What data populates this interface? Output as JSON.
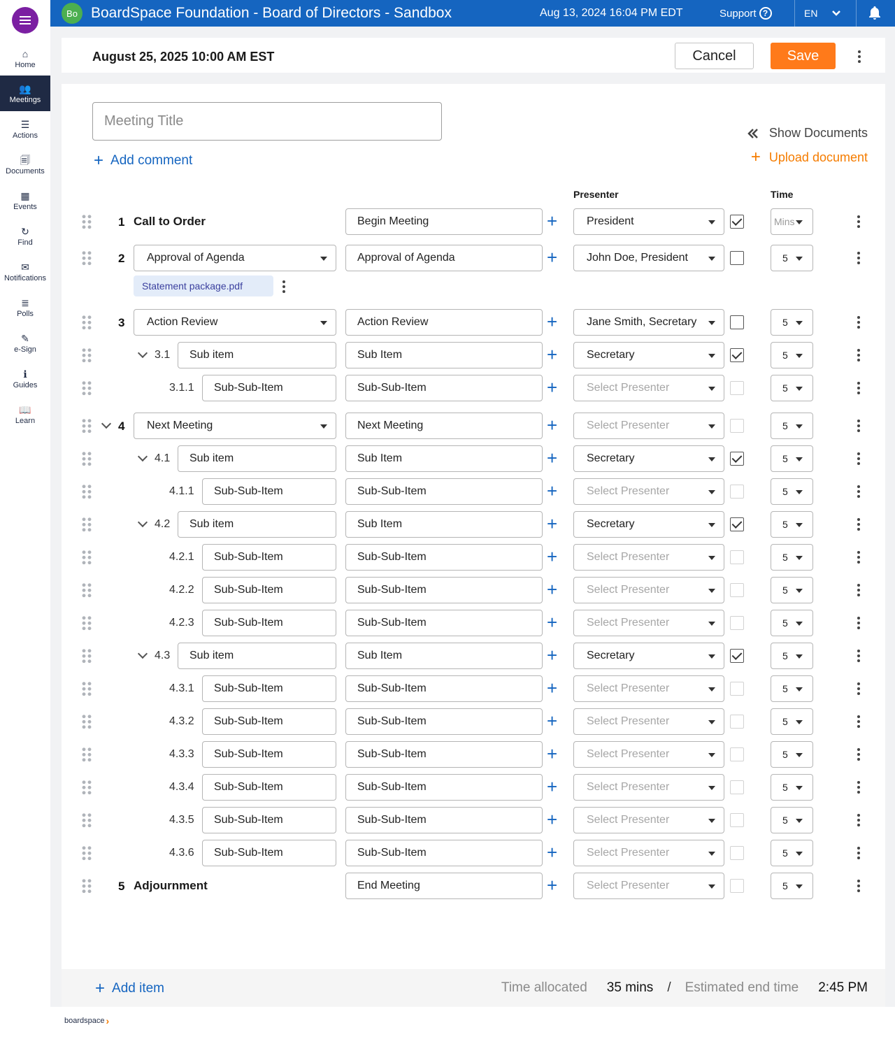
{
  "app": {
    "org_badge": "Bo",
    "title": "BoardSpace Foundation - Board of Directors - Sandbox",
    "datetime": "Aug 13, 2024 16:04 PM  EDT",
    "support_label": "Support",
    "language": "EN",
    "brand_color": "#1565c0"
  },
  "sidebar": {
    "items": [
      {
        "label": "Home",
        "icon": "home-icon",
        "glyph": "⌂"
      },
      {
        "label": "Meetings",
        "icon": "people-icon",
        "glyph": "👥",
        "active": true
      },
      {
        "label": "Actions",
        "icon": "list-icon",
        "glyph": "☰"
      },
      {
        "label": "Documents",
        "icon": "document-icon",
        "glyph": "🗐"
      },
      {
        "label": "Events",
        "icon": "calendar-icon",
        "glyph": "▦"
      },
      {
        "label": "Find",
        "icon": "history-icon",
        "glyph": "↻"
      },
      {
        "label": "Notifications",
        "icon": "envelope-icon",
        "glyph": "✉"
      },
      {
        "label": "Polls",
        "icon": "polls-icon",
        "glyph": "≣"
      },
      {
        "label": "e-Sign",
        "icon": "pen-icon",
        "glyph": "✎"
      },
      {
        "label": "Guides",
        "icon": "info-icon",
        "glyph": "ℹ"
      },
      {
        "label": "Learn",
        "icon": "book-icon",
        "glyph": "📖"
      }
    ]
  },
  "header": {
    "meeting_date": "August 25, 2025 10:00 AM EST",
    "cancel_label": "Cancel",
    "save_label": "Save",
    "save_color": "#ff7a1a"
  },
  "main": {
    "title_placeholder": "Meeting Title",
    "add_comment_label": "Add comment",
    "show_documents_label": "Show Documents",
    "upload_document_label": "Upload document",
    "presenter_header": "Presenter",
    "time_header": "Time",
    "attachment": "Statement package.pdf"
  },
  "agenda": [
    {
      "num": "1",
      "level": 0,
      "title": "Call to Order",
      "desc": "Begin Meeting",
      "presenter": "President",
      "presenter_set": true,
      "checked": true,
      "time": "Mins",
      "time_set": false
    },
    {
      "num": "2",
      "level": 0,
      "select": "Approval of Agenda",
      "desc": "Approval of Agenda",
      "presenter": "John Doe, President",
      "presenter_set": true,
      "checked": false,
      "time": "5",
      "time_set": true
    },
    {
      "num": "3",
      "level": 0,
      "select": "Action Review",
      "desc": "Action Review",
      "presenter": "Jane Smith, Secretary",
      "presenter_set": true,
      "checked": false,
      "time": "5",
      "time_set": true
    },
    {
      "num": "3.1",
      "level": 1,
      "collapsible": true,
      "name": "Sub item",
      "desc": "Sub Item",
      "presenter": "Secretary",
      "presenter_set": true,
      "checked": true,
      "time": "5",
      "time_set": true
    },
    {
      "num": "3.1.1",
      "level": 2,
      "name": "Sub-Sub-Item",
      "desc": "Sub-Sub-Item",
      "presenter": "Select Presenter",
      "presenter_set": false,
      "checked": false,
      "time": "5",
      "time_set": true
    },
    {
      "num": "4",
      "level": 0,
      "collapsible": true,
      "select": "Next Meeting",
      "desc": "Next Meeting",
      "presenter": "Select Presenter",
      "presenter_set": false,
      "checked": false,
      "time": "5",
      "time_set": true
    },
    {
      "num": "4.1",
      "level": 1,
      "collapsible": true,
      "name": "Sub item",
      "desc": "Sub Item",
      "presenter": "Secretary",
      "presenter_set": true,
      "checked": true,
      "time": "5",
      "time_set": true
    },
    {
      "num": "4.1.1",
      "level": 2,
      "name": "Sub-Sub-Item",
      "desc": "Sub-Sub-Item",
      "presenter": "Select Presenter",
      "presenter_set": false,
      "checked": false,
      "time": "5",
      "time_set": true
    },
    {
      "num": "4.2",
      "level": 1,
      "collapsible": true,
      "name": "Sub item",
      "desc": "Sub Item",
      "presenter": "Secretary",
      "presenter_set": true,
      "checked": true,
      "time": "5",
      "time_set": true
    },
    {
      "num": "4.2.1",
      "level": 2,
      "name": "Sub-Sub-Item",
      "desc": "Sub-Sub-Item",
      "presenter": "Select Presenter",
      "presenter_set": false,
      "checked": false,
      "time": "5",
      "time_set": true
    },
    {
      "num": "4.2.2",
      "level": 2,
      "name": "Sub-Sub-Item",
      "desc": "Sub-Sub-Item",
      "presenter": "Select Presenter",
      "presenter_set": false,
      "checked": false,
      "time": "5",
      "time_set": true
    },
    {
      "num": "4.2.3",
      "level": 2,
      "name": "Sub-Sub-Item",
      "desc": "Sub-Sub-Item",
      "presenter": "Select Presenter",
      "presenter_set": false,
      "checked": false,
      "time": "5",
      "time_set": true
    },
    {
      "num": "4.3",
      "level": 1,
      "collapsible": true,
      "name": "Sub item",
      "desc": "Sub Item",
      "presenter": "Secretary",
      "presenter_set": true,
      "checked": true,
      "time": "5",
      "time_set": true
    },
    {
      "num": "4.3.1",
      "level": 2,
      "name": "Sub-Sub-Item",
      "desc": "Sub-Sub-Item",
      "presenter": "Select Presenter",
      "presenter_set": false,
      "checked": false,
      "time": "5",
      "time_set": true
    },
    {
      "num": "4.3.2",
      "level": 2,
      "name": "Sub-Sub-Item",
      "desc": "Sub-Sub-Item",
      "presenter": "Select Presenter",
      "presenter_set": false,
      "checked": false,
      "time": "5",
      "time_set": true
    },
    {
      "num": "4.3.3",
      "level": 2,
      "name": "Sub-Sub-Item",
      "desc": "Sub-Sub-Item",
      "presenter": "Select Presenter",
      "presenter_set": false,
      "checked": false,
      "time": "5",
      "time_set": true
    },
    {
      "num": "4.3.4",
      "level": 2,
      "name": "Sub-Sub-Item",
      "desc": "Sub-Sub-Item",
      "presenter": "Select Presenter",
      "presenter_set": false,
      "checked": false,
      "time": "5",
      "time_set": true
    },
    {
      "num": "4.3.5",
      "level": 2,
      "name": "Sub-Sub-Item",
      "desc": "Sub-Sub-Item",
      "presenter": "Select Presenter",
      "presenter_set": false,
      "checked": false,
      "time": "5",
      "time_set": true
    },
    {
      "num": "4.3.6",
      "level": 2,
      "name": "Sub-Sub-Item",
      "desc": "Sub-Sub-Item",
      "presenter": "Select Presenter",
      "presenter_set": false,
      "checked": false,
      "time": "5",
      "time_set": true
    },
    {
      "num": "5",
      "level": 0,
      "title": "Adjournment",
      "desc": "End Meeting",
      "presenter": "Select Presenter",
      "presenter_set": false,
      "checked": false,
      "time": "5",
      "time_set": true
    }
  ],
  "footer": {
    "add_item_label": "Add item",
    "time_allocated_label": "Time allocated",
    "time_allocated_value": "35 mins",
    "separator": "/",
    "end_time_label": "Estimated end time",
    "end_time_value": "2:45 PM",
    "logo_text": "boardspace"
  }
}
